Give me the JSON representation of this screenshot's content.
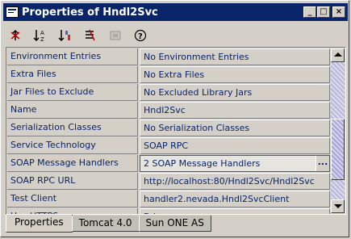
{
  "window": {
    "title": "Properties of Hndl2Svc",
    "controls": {
      "minimize": "_",
      "maximize": "□",
      "close": "×"
    }
  },
  "toolbar": {
    "items": [
      {
        "name": "unsorted-icon"
      },
      {
        "name": "sort-by-name-icon"
      },
      {
        "name": "sort-by-type-icon"
      },
      {
        "name": "show-editable-only-icon"
      },
      {
        "name": "customize-icon"
      },
      {
        "name": "help-icon"
      }
    ]
  },
  "properties": [
    {
      "name": "Environment Entries",
      "value": "No Environment Entries"
    },
    {
      "name": "Extra Files",
      "value": "No Extra Files"
    },
    {
      "name": "Jar Files to Exclude",
      "value": "No Excluded Library Jars"
    },
    {
      "name": "Name",
      "value": "Hndl2Svc"
    },
    {
      "name": "Serialization Classes",
      "value": "No Serialization Classes"
    },
    {
      "name": "Service Technology",
      "value": "SOAP RPC"
    },
    {
      "name": "SOAP Message Handlers",
      "value": "2 SOAP Message Handlers",
      "ellipsis": "..."
    },
    {
      "name": "SOAP RPC URL",
      "value": "http://localhost:80/Hndl2Svc/Hndl2Svc"
    },
    {
      "name": "Test Client",
      "value": "handler2.nevada.Hndl2SvcClient"
    },
    {
      "name": "Use HTTPS",
      "value": "False"
    }
  ],
  "tabs": [
    {
      "label": "Properties",
      "active": true
    },
    {
      "label": "Tomcat 4.0",
      "active": false
    },
    {
      "label": "Sun ONE AS",
      "active": false
    }
  ],
  "colors": {
    "title_bg": "#0a246a",
    "property_text": "#0a246a",
    "window_bg": "#d4d0c8"
  }
}
